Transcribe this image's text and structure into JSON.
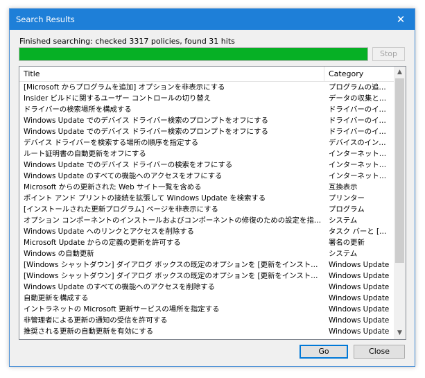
{
  "window": {
    "title": "Search Results",
    "close_glyph": "✕"
  },
  "status": "Finished searching: checked 3317 policies, found 31 hits",
  "progress": {
    "percent": 100,
    "color": "#06b025"
  },
  "buttons": {
    "stop": "Stop",
    "go": "Go",
    "close": "Close"
  },
  "list": {
    "columns": {
      "title": "Title",
      "category": "Category"
    },
    "rows": [
      {
        "title": "[Microsoft からプログラムを追加] オプションを非表示にする",
        "category": "プログラムの追加..."
      },
      {
        "title": "Insider ビルドに関するユーザー コントロールの切り替え",
        "category": "データの収集とプ..."
      },
      {
        "title": "ドライバーの検索場所を構成する",
        "category": "ドライバーのイン..."
      },
      {
        "title": "Windows Update でのデバイス ドライバー検索のプロンプトをオフにする",
        "category": "ドライバーのイン..."
      },
      {
        "title": "Windows Update でのデバイス ドライバー検索のプロンプトをオフにする",
        "category": "ドライバーのイン..."
      },
      {
        "title": "デバイス ドライバーを検索する場所の順序を指定する",
        "category": "デバイスのインス..."
      },
      {
        "title": "ルート証明書の自動更新をオフにする",
        "category": "インターネット通..."
      },
      {
        "title": "Windows Update でのデバイス ドライバーの検索をオフにする",
        "category": "インターネット通..."
      },
      {
        "title": "Windows Update のすべての機能へのアクセスをオフにする",
        "category": "インターネット通..."
      },
      {
        "title": "Microsoft からの更新された Web サイト一覧を含める",
        "category": "互換表示"
      },
      {
        "title": "ポイント アンド プリントの接続を拡張して Windows Update を検索する",
        "category": "プリンター"
      },
      {
        "title": "[インストールされた更新プログラム] ページを非表示にする",
        "category": "プログラム"
      },
      {
        "title": "オプション コンポーネントのインストールおよびコンポーネントの修復のための設定を指定する",
        "category": "システム"
      },
      {
        "title": "Windows Update へのリンクとアクセスを削除する",
        "category": "タスク バーと [ス..."
      },
      {
        "title": "Microsoft Update からの定義の更新を許可する",
        "category": "署名の更新"
      },
      {
        "title": "Windows の自動更新",
        "category": "システム"
      },
      {
        "title": "[Windows シャットダウン] ダイアログ ボックスの既定のオプションを [更新をインストールしてシ...",
        "category": "Windows Update"
      },
      {
        "title": "[Windows シャットダウン] ダイアログ ボックスの既定のオプションを [更新をインストールしてシ...",
        "category": "Windows Update"
      },
      {
        "title": "Windows Update のすべての機能へのアクセスを削除する",
        "category": "Windows Update"
      },
      {
        "title": "自動更新を構成する",
        "category": "Windows Update"
      },
      {
        "title": "イントラネットの Microsoft 更新サービスの場所を指定する",
        "category": "Windows Update"
      },
      {
        "title": "非管理者による更新の通知の受信を許可する",
        "category": "Windows Update"
      },
      {
        "title": "推奨される更新の自動更新を有効にする",
        "category": "Windows Update"
      }
    ]
  },
  "scrollbar": {
    "up_glyph": "▲",
    "down_glyph": "▼"
  }
}
